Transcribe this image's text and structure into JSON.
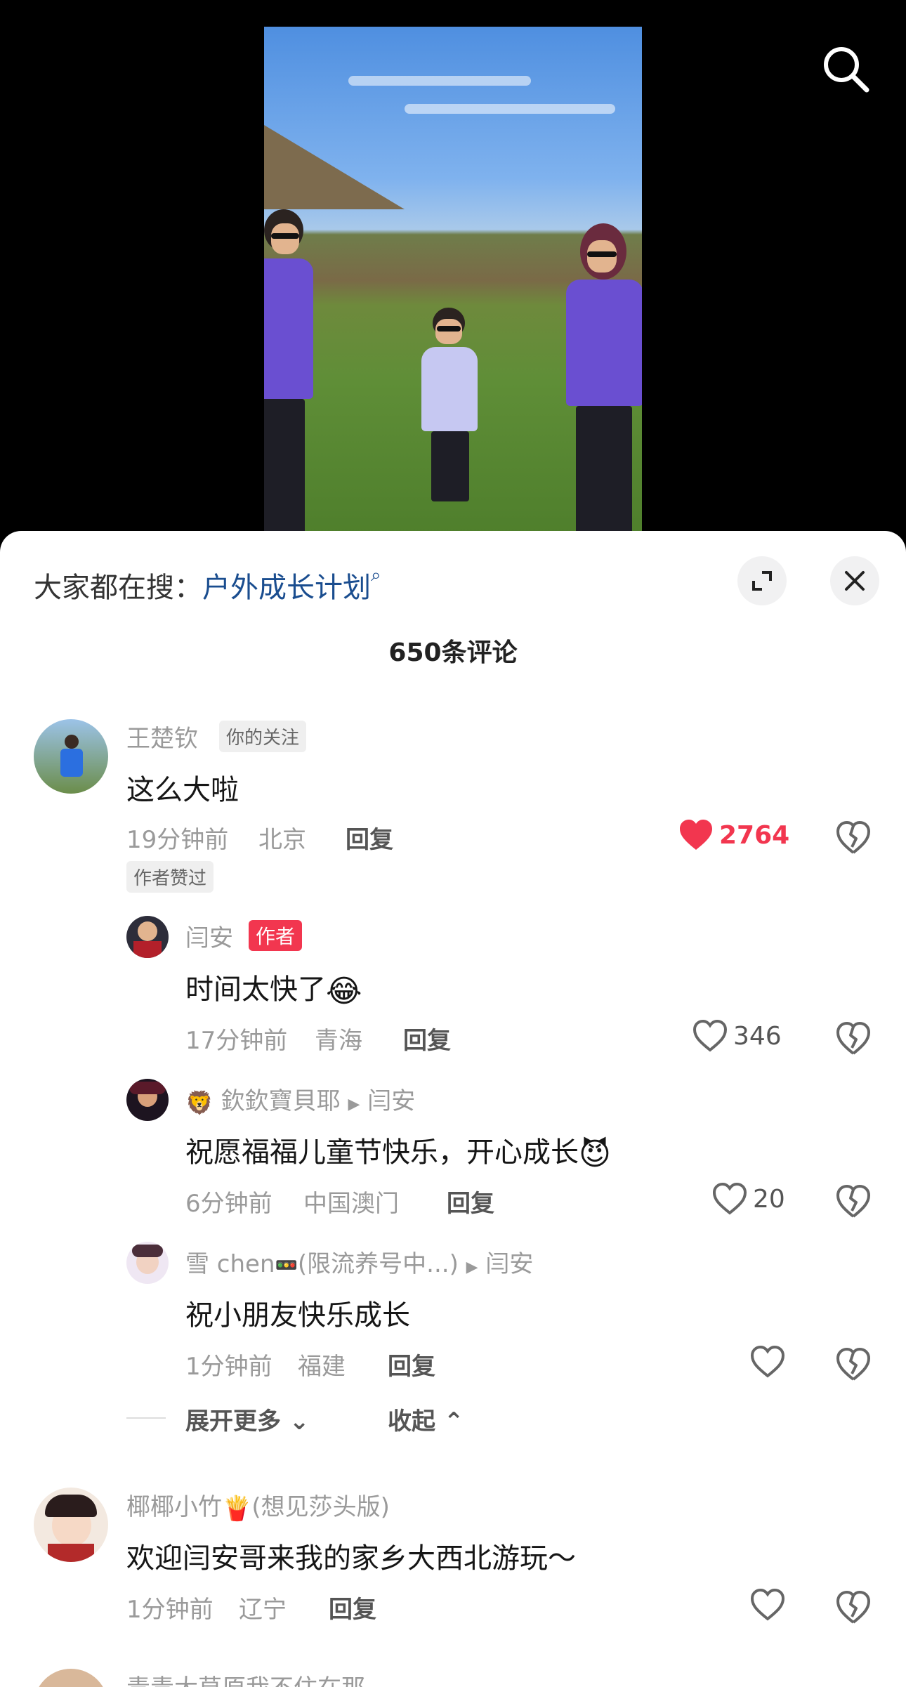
{
  "hot_search": {
    "prefix": "大家都在搜：",
    "keyword": "户外成长计划"
  },
  "comment_count_label": "650条评论",
  "comments": [
    {
      "user": "王楚钦",
      "follow_tag": "你的关注",
      "text": "这么大啦",
      "time": "19分钟前",
      "location": "北京",
      "reply": "回复",
      "likes": "2764",
      "author_liked_tag": "作者赞过",
      "replies": [
        {
          "user": "闫安",
          "author_tag": "作者",
          "text": "时间太快了",
          "time": "17分钟前",
          "location": "青海",
          "reply": "回复",
          "likes": "346"
        },
        {
          "user": "欽欽寶貝耶",
          "reply_to": "闫安",
          "text": "祝愿福福儿童节快乐，开心成长",
          "time": "6分钟前",
          "location": "中国澳门",
          "reply": "回复",
          "likes": "20"
        },
        {
          "user": "雪 chen",
          "user_suffix": "(限流养号中...)",
          "reply_to": "闫安",
          "text": "祝小朋友快乐成长",
          "time": "1分钟前",
          "location": "福建",
          "reply": "回复",
          "likes": ""
        }
      ],
      "expand_more": "展开更多",
      "collapse": "收起"
    },
    {
      "user": "椰椰小竹",
      "user_suffix": "(想见莎头版)",
      "text": "欢迎闫安哥来我的家乡大西北游玩～",
      "time": "1分钟前",
      "location": "辽宁",
      "reply": "回复",
      "likes": ""
    },
    {
      "user": "青青大草原我不住在那",
      "text": "",
      "time": "",
      "location": "",
      "reply": "",
      "likes": ""
    }
  ],
  "colors": {
    "accent": "#f2364f",
    "link": "#1a4d8f"
  },
  "icons": [
    "search-icon",
    "fullscreen-icon",
    "close-icon",
    "heart-icon",
    "dislike-icon",
    "chevron-down-icon",
    "chevron-up-icon"
  ]
}
